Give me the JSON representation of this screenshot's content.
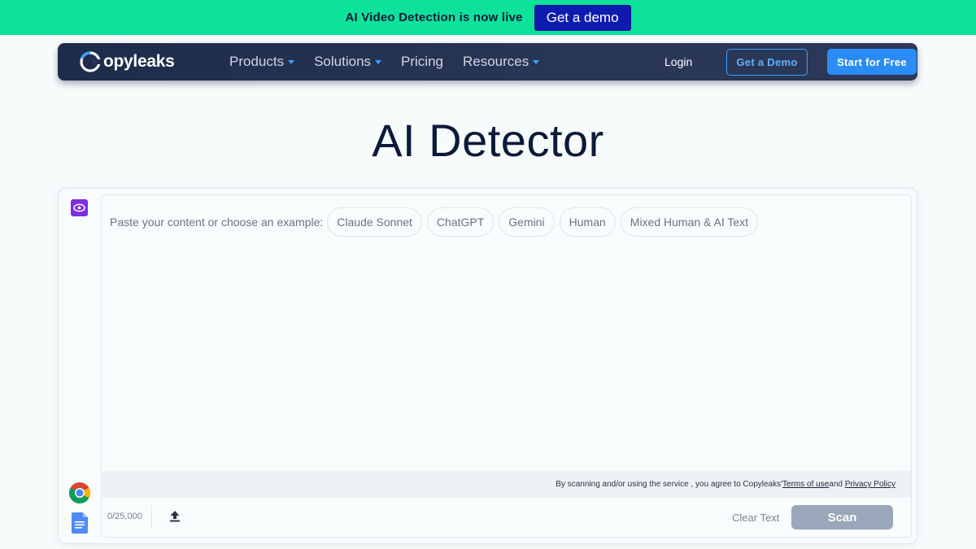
{
  "banner": {
    "text": "AI Video Detection is now live",
    "button_label": "Get a demo",
    "bg_color": "#0ee29a"
  },
  "nav": {
    "logo_text": "opyleaks",
    "menu": [
      {
        "label": "Products",
        "has_dropdown": true
      },
      {
        "label": "Solutions",
        "has_dropdown": true
      },
      {
        "label": "Pricing",
        "has_dropdown": false
      },
      {
        "label": "Resources",
        "has_dropdown": true
      }
    ],
    "login_label": "Login",
    "demo_label": "Get a Demo",
    "start_label": "Start for Free",
    "accent_color": "#2b8cf5"
  },
  "main": {
    "title": "AI Detector",
    "prompt_label": "Paste your content or choose an example:",
    "examples": [
      "Claude Sonnet",
      "ChatGPT",
      "Gemini",
      "Human",
      "Mixed Human & AI Text"
    ],
    "terms_prefix": "By scanning and/or using the service , you agree to Copyleaks' ",
    "terms_link": "Terms of use ",
    "terms_and": "and ",
    "privacy_link": "Privacy Policy",
    "counter": "0/25,000",
    "clear_label": "Clear Text",
    "scan_label": "Scan",
    "side_icons": [
      "eye-icon",
      "chrome-icon",
      "google-docs-icon"
    ],
    "upload_icon": "upload-icon"
  }
}
